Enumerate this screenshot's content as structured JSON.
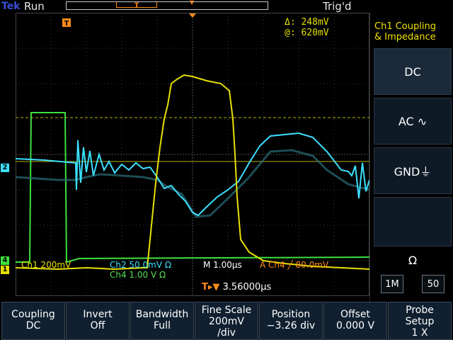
{
  "status": {
    "brand": "Tek",
    "state": "Run",
    "trigger_status": "Trig'd"
  },
  "measurement": {
    "delta_label": "Δ:",
    "delta_value": "248mV",
    "at_label": "@:",
    "at_value": "620mV"
  },
  "readout": {
    "ch1": "Ch1 200mV",
    "ch2": "Ch2 50.0mV Ω",
    "timebase": "M 1.00µs",
    "trigger": "A Ch4 ╱ 80.0mV",
    "ch4": "Ch4 1.00 V Ω"
  },
  "trigger_position": "3.56000µs",
  "channel_markers": {
    "ch1": "1",
    "ch2": "2",
    "ch4": "4"
  },
  "side_menu": {
    "title_line1": "Ch1 Coupling",
    "title_line2": "& Impedance",
    "options": [
      "DC",
      "AC ∿",
      "GND⏚"
    ],
    "impedance_symbol": "Ω",
    "impedance_options": [
      "1M",
      "50"
    ]
  },
  "bottom_menu": [
    {
      "line1": "Coupling",
      "line2": "DC"
    },
    {
      "line1": "Invert",
      "line2": "Off"
    },
    {
      "line1": "Bandwidth",
      "line2": "Full"
    },
    {
      "line1": "Fine Scale",
      "line2": "200mV",
      "line3": "/div"
    },
    {
      "line1": "Position",
      "line2": "−3.26 div"
    },
    {
      "line1": "Offset",
      "line2": "0.000 V"
    },
    {
      "line1": "Probe",
      "line2": "Setup",
      "line3": "1 X"
    }
  ],
  "colors": {
    "ch1": "#e8e000",
    "ch2": "#3ce0ff",
    "ch4": "#3fe03f",
    "trigger": "#ff8c1a",
    "grid": "#4a4a4a"
  }
}
